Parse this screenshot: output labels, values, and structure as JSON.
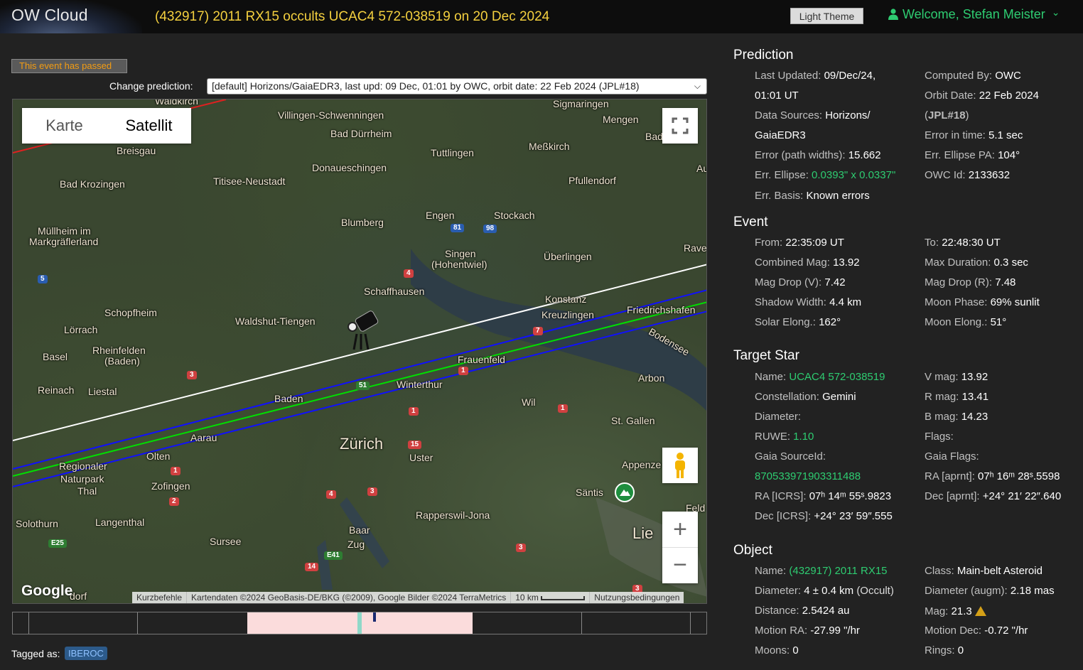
{
  "header": {
    "app_name": "OW Cloud",
    "event_title": "(432917) 2011 RX15 occults UCAC4 572-038519 on 20 Dec 2024",
    "theme_button": "Light Theme",
    "welcome": "Welcome, Stefan Meister",
    "welcome_chevron": "⌄"
  },
  "status": {
    "passed": "This event has passed"
  },
  "prediction_selector": {
    "label": "Change prediction:",
    "selected": "[default] Horizons/GaiaEDR3, last upd: 09 Dec, 01:01 by OWC, orbit date: 22 Feb 2024 (JPL#18)"
  },
  "map": {
    "type_tabs": [
      "Karte",
      "Satellit"
    ],
    "active_tab": "Satellit",
    "fullscreen_icon": "fullscreen-icon",
    "pegman_icon": "pegman-icon",
    "zoom_in": "+",
    "zoom_out": "−",
    "google": "Google",
    "attribution": [
      "Kurzbefehle",
      "Kartendaten ©2024 GeoBasis-DE/BKG (©2009), Google Bilder ©2024 TerraMetrics",
      "10 km",
      "Nutzungsbedingungen"
    ],
    "labels": {
      "waldkirch": "Waldkirch",
      "villingen": "Villingen-Schwenningen",
      "sigmaringen": "Sigmaringen",
      "mengen": "Mengen",
      "bad": "Bad",
      "breisgau": "Breisgau",
      "bad_durrheim": "Bad Dürrheim",
      "tuttlingen": "Tuttlingen",
      "messkirch": "Meßkirch",
      "au": "Au",
      "donaueschingen": "Donaueschingen",
      "titisee": "Titisee-Neustadt",
      "pfullendorf": "Pfullendorf",
      "bad_krozingen": "Bad Krozingen",
      "engen": "Engen",
      "stockach": "Stockach",
      "blumberg": "Blumberg",
      "mullheim": "Müllheim im",
      "markgrafler": "Markgräflerland",
      "rave": "Rave",
      "singen": "Singen",
      "hohentwiel": "(Hohentwiel)",
      "uberlingen": "Überlingen",
      "schaffhausen": "Schaffhausen",
      "konstanz": "Konstanz",
      "kreuzlingen": "Kreuzlingen",
      "friedrichshafen": "Friedrichshafen",
      "schopfheim": "Schopfheim",
      "waldshut": "Waldshut-Tiengen",
      "lorrach": "Lörrach",
      "bodensee": "Bodensee",
      "basel": "Basel",
      "rheinfelden": "Rheinfelden",
      "baden_ch": "(Baden)",
      "frauenfeld": "Frauenfeld",
      "arbon": "Arbon",
      "reinach": "Reinach",
      "liestal": "Liestal",
      "baden": "Baden",
      "winterthur": "Winterthur",
      "wil": "Wil",
      "st_gallen": "St. Gallen",
      "aarau": "Aarau",
      "zurich": "Zürich",
      "uster": "Uster",
      "olten": "Olten",
      "appenzell": "Appenze",
      "regionaler": "Regionaler",
      "naturpark": "Naturpark",
      "thal": "Thal",
      "zofingen": "Zofingen",
      "santis": "Säntis",
      "solothurn": "Solothurn",
      "langenthal": "Langenthal",
      "rapperswil": "Rapperswil-Jona",
      "feld": "Feld",
      "baar": "Baar",
      "zug": "Zug",
      "sursee": "Sursee",
      "liech": "Lie",
      "burgdorf": "dorf"
    },
    "roads": {
      "r81": "81",
      "r98": "98",
      "r5": "5",
      "r4a": "4",
      "r7": "7",
      "r3a": "3",
      "r1a": "1",
      "r51": "51",
      "r1b": "1",
      "r1c": "1",
      "r15": "15",
      "r1d": "1",
      "r4b": "4",
      "r3b": "3",
      "r2": "2",
      "r25": "E25",
      "r41": "E41",
      "r14": "14",
      "r3c": "3",
      "r3d": "3"
    }
  },
  "timeline": {},
  "tags": {
    "label": "Tagged as:",
    "items": [
      "IBEROC"
    ]
  },
  "prediction": {
    "title": "Prediction",
    "last_updated_k": "Last Updated:",
    "last_updated_v1": "09/Dec/24,",
    "last_updated_v2": "01:01 UT",
    "computed_by_k": "Computed By:",
    "computed_by_v": "OWC",
    "orbit_date_k": "Orbit Date:",
    "orbit_date_v": "22 Feb 2024",
    "orbit_ref_open": "(",
    "orbit_ref": "JPL#18",
    "orbit_ref_close": ")",
    "data_sources_k": "Data Sources:",
    "data_sources_v1": "Horizons/",
    "data_sources_v2": "GaiaEDR3",
    "error_time_k": "Error in time:",
    "error_time_v": "5.1 sec",
    "error_path_k": "Error (path widths):",
    "error_path_v": "15.662",
    "ellipse_pa_k": "Err. Ellipse PA:",
    "ellipse_pa_v": "104°",
    "ellipse_k": "Err. Ellipse:",
    "ellipse_v": "0.0393\" x 0.0337\"",
    "owc_id_k": "OWC Id:",
    "owc_id_v": "2133632",
    "basis_k": "Err. Basis:",
    "basis_v": "Known errors"
  },
  "event": {
    "title": "Event",
    "from_k": "From:",
    "from_v": "22:35:09 UT",
    "to_k": "To:",
    "to_v": "22:48:30 UT",
    "comb_mag_k": "Combined Mag:",
    "comb_mag_v": "13.92",
    "max_dur_k": "Max Duration:",
    "max_dur_v": "0.3 sec",
    "drop_v_k": "Mag Drop (V):",
    "drop_v_v": "7.42",
    "drop_r_k": "Mag Drop (R):",
    "drop_r_v": "7.48",
    "shadow_k": "Shadow Width:",
    "shadow_v": "4.4 km",
    "moon_phase_k": "Moon Phase:",
    "moon_phase_v": "69% sunlit",
    "solar_k": "Solar Elong.:",
    "solar_v": "162°",
    "moon_el_k": "Moon Elong.:",
    "moon_el_v": "51°"
  },
  "star": {
    "title": "Target Star",
    "name_k": "Name:",
    "name_v": "UCAC4 572-038519",
    "vmag_k": "V mag:",
    "vmag_v": "13.92",
    "const_k": "Constellation:",
    "const_v": "Gemini",
    "rmag_k": "R mag:",
    "rmag_v": "13.41",
    "diam_k": "Diameter:",
    "bmag_k": "B mag:",
    "bmag_v": "14.23",
    "ruwe_k": "RUWE:",
    "ruwe_v": "1.10",
    "flags_k": "Flags:",
    "gaia_k": "Gaia SourceId:",
    "gaia_flags_k": "Gaia Flags:",
    "gaia_v": "870533971903311488",
    "ra_aprnt_k": "RA [aprnt]:",
    "ra_aprnt_v": "07ʰ 16ᵐ 28ˢ.5598",
    "ra_icrs_k": "RA [ICRS]:",
    "ra_icrs_v": "07ʰ 14ᵐ 55ˢ.9823",
    "dec_aprnt_k": "Dec [aprnt]:",
    "dec_aprnt_v": "+24° 21′ 22″.640",
    "dec_icrs_k": "Dec [ICRS]:",
    "dec_icrs_v": "+24° 23′ 59″.555"
  },
  "object": {
    "title": "Object",
    "name_k": "Name:",
    "name_v": "(432917) 2011 RX15",
    "class_k": "Class:",
    "class_v": "Main-belt Asteroid",
    "diam_k": "Diameter:",
    "diam_v": "4 ± 0.4 km",
    "diam_src": "(Occult)",
    "diam_aug_k": "Diameter (augm):",
    "diam_aug_v": "2.18 mas",
    "dist_k": "Distance:",
    "dist_v": "2.5424 au",
    "mag_k": "Mag:",
    "mag_v": "21.3",
    "mra_k": "Motion RA:",
    "mra_v": "-27.99 \"/hr",
    "mdec_k": "Motion Dec:",
    "mdec_v": "-0.72 \"/hr",
    "moons_k": "Moons:",
    "moons_v": "0",
    "rings_k": "Rings:",
    "rings_v": "0"
  },
  "colors": {
    "title_yellow": "#f4d03f",
    "accent_green": "#2ecc71",
    "path_center": "#00e000",
    "path_limits": "#1010ff",
    "path_sigma": "#ffffff",
    "warning": "#f39c12"
  }
}
